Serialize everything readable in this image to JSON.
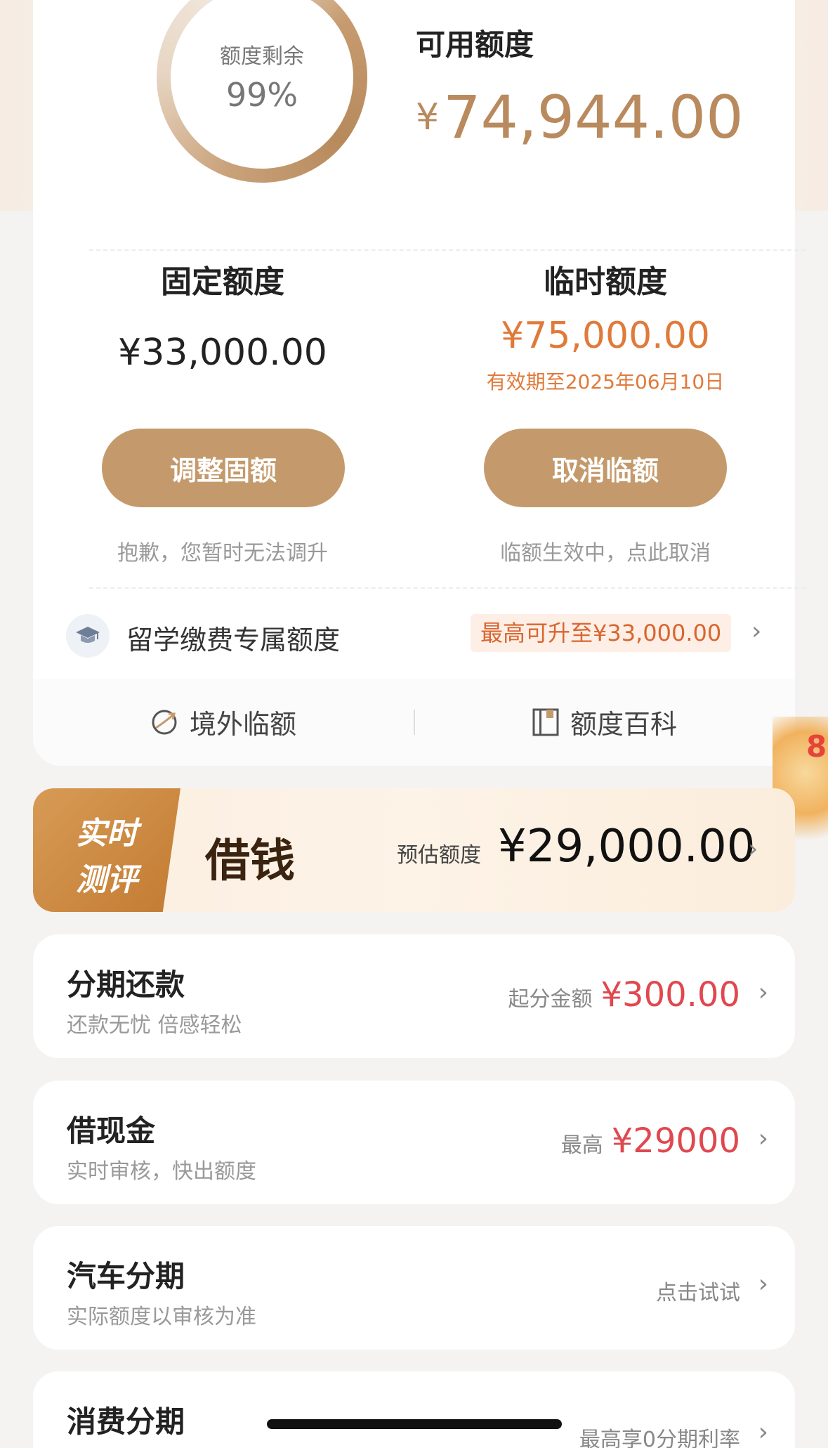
{
  "quota": {
    "ring_label": "额度剩余",
    "ring_percent": "99%",
    "available_title": "可用额度",
    "available_currency": "¥",
    "available_amount": "74,944.00",
    "fixed": {
      "title": "固定额度",
      "amount": "¥33,000.00",
      "button": "调整固额",
      "note": "抱歉，您暂时无法调升"
    },
    "temporary": {
      "title": "临时额度",
      "amount": "¥75,000.00",
      "validity": "有效期至2025年06月10日",
      "button": "取消临额",
      "note": "临额生效中，点此取消"
    },
    "study": {
      "label": "留学缴费专属额度",
      "tag": "最高可升至¥33,000.00"
    }
  },
  "sub_bar": {
    "overseas": "境外临额",
    "encyclopedia": "额度百科"
  },
  "loan_banner": {
    "tag_line1": "实时",
    "tag_line2": "测评",
    "title": "借钱",
    "est_label": "预估额度",
    "est_amount": "¥29,000.00",
    "side_float_text": "8"
  },
  "list": [
    {
      "title": "分期还款",
      "subtitle": "还款无忧 倍感轻松",
      "label": "起分金额",
      "value": "¥300.00"
    },
    {
      "title": "借现金",
      "subtitle": "实时审核，快出额度",
      "label": "最高",
      "value": "¥29000"
    },
    {
      "title": "汽车分期",
      "subtitle": "实际额度以审核为准",
      "label": "点击试试",
      "value": ""
    },
    {
      "title": "消费分期",
      "subtitle": "",
      "label": "最高享0分期利率",
      "value": ""
    }
  ],
  "colors": {
    "gold": "#c49a6c",
    "amount_gold": "#b98a5d",
    "orange": "#e07a3a",
    "red": "#e0484f"
  }
}
